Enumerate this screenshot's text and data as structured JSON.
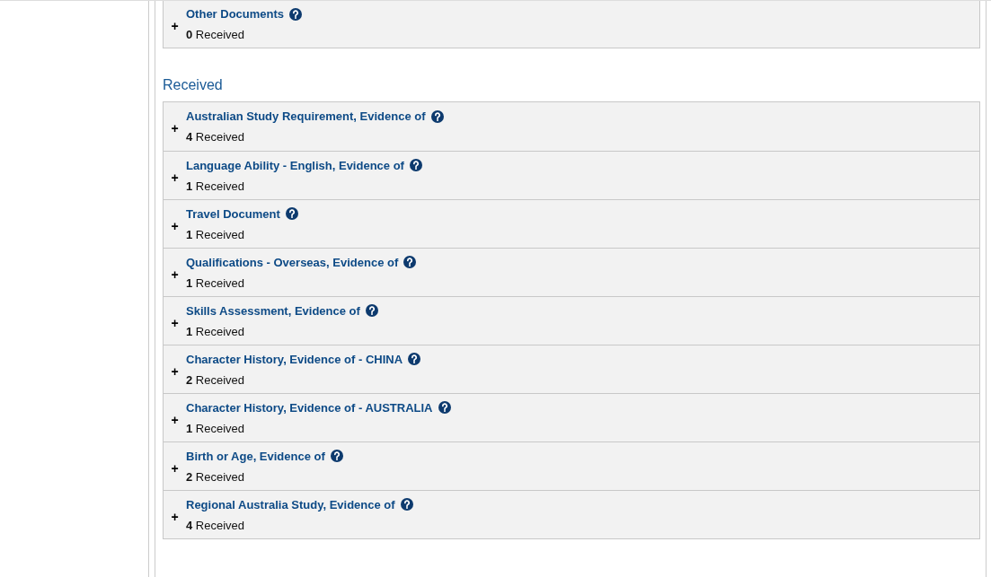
{
  "sections": [
    {
      "items": [
        {
          "toggle": "+",
          "title": "Other Documents",
          "count": "**0** Received"
        }
      ]
    },
    {
      "heading": "Received",
      "items": [
        {
          "toggle": "+",
          "title": "Australian Study Requirement, Evidence of",
          "count": "**4** Received"
        },
        {
          "toggle": "+",
          "title": "Language Ability - English, Evidence of",
          "count": "**1** Received"
        },
        {
          "toggle": "+",
          "title": "Travel Document",
          "count": "**1** Received"
        },
        {
          "toggle": "+",
          "title": "Qualifications - Overseas, Evidence of",
          "count": "**1** Received"
        },
        {
          "toggle": "+",
          "title": "Skills Assessment, Evidence of",
          "count": "**1** Received"
        },
        {
          "toggle": "+",
          "title": "Character History, Evidence of - CHINA",
          "count": "**2** Received"
        },
        {
          "toggle": "+",
          "title": "Character History, Evidence of - AUSTRALIA",
          "count": "**1** Received"
        },
        {
          "toggle": "+",
          "title": "Birth or Age, Evidence of",
          "count": "**2** Received"
        },
        {
          "toggle": "+",
          "title": "Regional Australia Study, Evidence of",
          "count": "**4** Received"
        }
      ]
    }
  ]
}
